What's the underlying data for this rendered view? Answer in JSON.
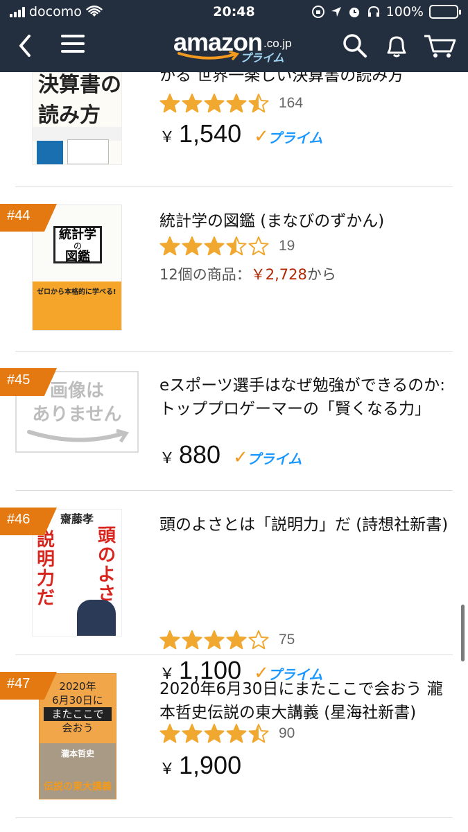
{
  "status_bar": {
    "carrier": "docomo",
    "time": "20:48",
    "battery": "100%"
  },
  "header": {
    "logo_text": "amazon",
    "logo_suffix": ".co.jp",
    "logo_prime": "プライム"
  },
  "icons": {
    "back": "chevron-left-icon",
    "menu": "hamburger-menu-icon",
    "search": "search-icon",
    "notifications": "bell-icon",
    "cart": "cart-icon"
  },
  "colors": {
    "header_bg": "#232f3e",
    "rank_tag": "#e47911",
    "star": "#f0a830",
    "prime_blue": "#1a98ff",
    "price_red": "#b12704"
  },
  "items": [
    {
      "title_tail": "かる 世界一楽しい決算書の読み方",
      "cover_text": "決算書の読み方",
      "rating": 4.5,
      "review_count": "164",
      "yen": "￥",
      "price": "1,540",
      "prime_label": "プライム"
    },
    {
      "rank": "#44",
      "title": "統計学の図鑑 (まなびのずかん)",
      "cover_text_1": "統計学",
      "cover_text_2": "の",
      "cover_text_3": "図鑑",
      "cover_caption": "ゼロから本格的に学べる!",
      "rating": 3.5,
      "review_count": "19",
      "offers_prefix": "12個の商品：",
      "offers_price": "￥2,728",
      "offers_suffix": "から"
    },
    {
      "rank": "#45",
      "title": "eスポーツ選手はなぜ勉強ができるのか: トッププロゲーマーの「賢くなる力」",
      "cover_text_1": "画像は",
      "cover_text_2": "ありません",
      "yen": "￥",
      "price": "880",
      "prime_label": "プライム"
    },
    {
      "rank": "#46",
      "title": "頭のよさとは「説明力」だ (詩想社新書)",
      "cover_author": "齋藤孝",
      "cover_text_1": "頭のよさ",
      "cover_text_2": "説明力だ",
      "rating": 4,
      "review_count": "75",
      "yen": "￥",
      "price": "1,100",
      "prime_label": "プライム"
    },
    {
      "rank": "#47",
      "title": "2020年6月30日にまたここで会おう 瀧本哲史伝説の東大講義 (星海社新書)",
      "cover_text_1": "2020年",
      "cover_text_2": "6月30日に",
      "cover_text_3": "またここで",
      "cover_text_4": "会おう",
      "cover_author": "瀧本哲史",
      "cover_text_5": "伝説の東大講義",
      "rating": 4.5,
      "review_count": "90",
      "yen": "￥",
      "price": "1,900"
    }
  ]
}
